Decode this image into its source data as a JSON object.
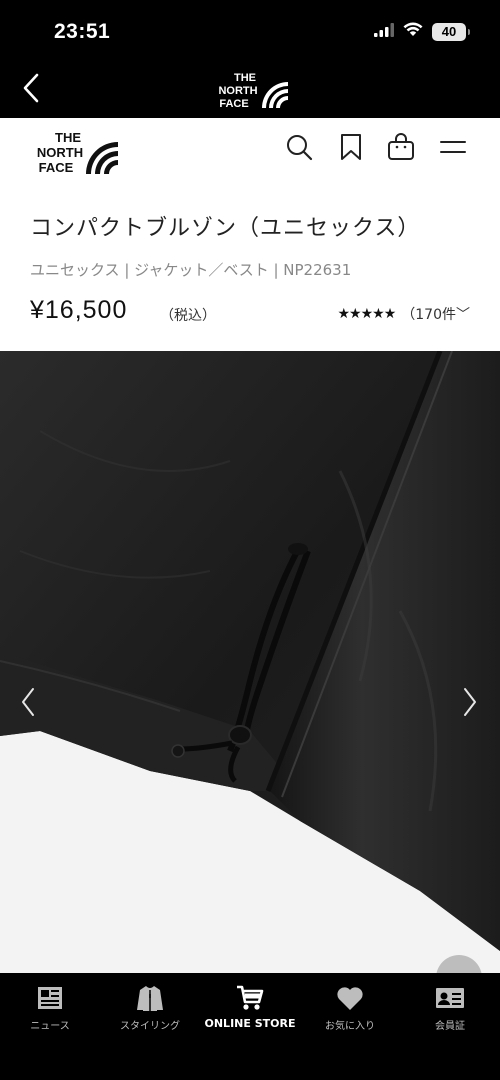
{
  "status_bar": {
    "time": "23:51",
    "battery": "40",
    "icons": [
      "signal-icon",
      "wifi-icon",
      "battery-icon"
    ]
  },
  "app_nav": {
    "back_icon": "chevron-left-icon",
    "logo_lines": [
      "THE",
      "NORTH",
      "FACE"
    ]
  },
  "site_header": {
    "logo_lines": [
      "THE",
      "NORTH",
      "FACE"
    ],
    "icons": [
      "search-icon",
      "bookmark-icon",
      "shopping-bag-icon",
      "menu-icon"
    ]
  },
  "product": {
    "title": "コンパクトブルゾン（ユニセックス）",
    "meta": "ユニセックス | ジャケット／ベスト | NP22631",
    "price": "¥16,500",
    "tax_label": "（税込）",
    "stars": "★★★★★",
    "review_count": "（170件",
    "review_chevron": "﹀"
  },
  "carousel": {
    "prev_icon": "chevron-left-icon",
    "next_icon": "chevron-right-icon"
  },
  "tab_bar": {
    "tabs": [
      {
        "label": "ニュース",
        "icon": "news-icon",
        "active": false
      },
      {
        "label": "スタイリング",
        "icon": "jacket-icon",
        "active": false
      },
      {
        "label": "ONLINE STORE",
        "icon": "cart-icon",
        "active": true
      },
      {
        "label": "お気に入り",
        "icon": "heart-icon",
        "active": false
      },
      {
        "label": "会員証",
        "icon": "member-card-icon",
        "active": false
      }
    ]
  },
  "colors": {
    "header_bg": "#000000",
    "text_primary": "#222222",
    "text_secondary": "#888888",
    "tab_inactive": "#bdbdbd",
    "tab_active": "#ffffff"
  }
}
